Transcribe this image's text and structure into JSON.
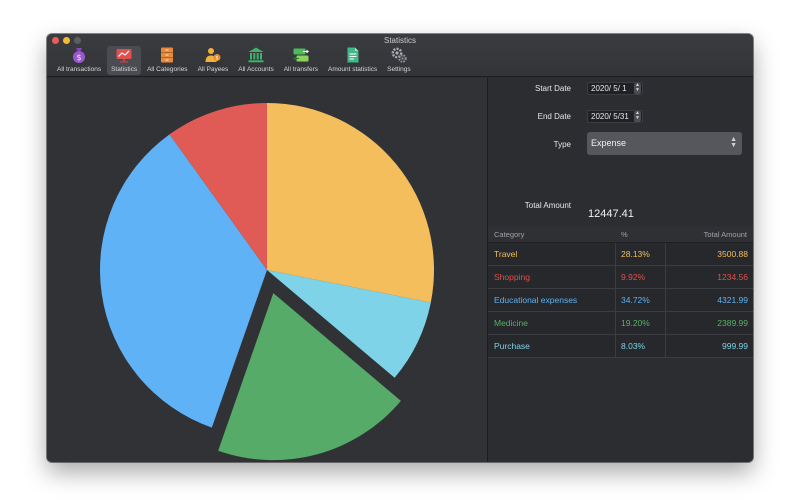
{
  "window": {
    "title": "Statistics"
  },
  "toolbar": {
    "items": [
      {
        "label": "All transactions",
        "icon": "money-bag-icon",
        "color": "#9b59d0",
        "active": false
      },
      {
        "label": "Statistics",
        "icon": "chart-icon",
        "color": "#e0504c",
        "active": true
      },
      {
        "label": "All Categories",
        "icon": "cabinet-icon",
        "color": "#e88a3c",
        "active": false
      },
      {
        "label": "All Payees",
        "icon": "people-icon",
        "color": "#f1b23d",
        "active": false
      },
      {
        "label": "All Accounts",
        "icon": "bank-icon",
        "color": "#3fb26b",
        "active": false
      },
      {
        "label": "All transfers",
        "icon": "transfer-icon",
        "color": "#4dbb5a",
        "active": false
      },
      {
        "label": "Amount statistics",
        "icon": "document-icon",
        "color": "#3fb98a",
        "active": false
      },
      {
        "label": "Settings",
        "icon": "gears-icon",
        "color": "#9aa0a6",
        "active": false
      }
    ]
  },
  "form": {
    "start_date_label": "Start Date",
    "start_date_value": "2020/ 5/ 1",
    "end_date_label": "End Date",
    "end_date_value": "2020/ 5/31",
    "type_label": "Type",
    "type_value": "Expense",
    "total_label": "Total Amount",
    "total_value": "12447.41"
  },
  "table": {
    "headers": {
      "category": "Category",
      "percent": "%",
      "amount": "Total Amount"
    },
    "rows": [
      {
        "category": "Travel",
        "percent": "28.13%",
        "amount": "3500.88",
        "color": "#f5be5c"
      },
      {
        "category": "Shopping",
        "percent": "9.92%",
        "amount": "1234.56",
        "color": "#e0504c"
      },
      {
        "category": "Educational expenses",
        "percent": "34.72%",
        "amount": "4321.99",
        "color": "#5fb2f5"
      },
      {
        "category": "Medicine",
        "percent": "19.20%",
        "amount": "2389.99",
        "color": "#5aaf6a"
      },
      {
        "category": "Purchase",
        "percent": "8.03%",
        "amount": "999.99",
        "color": "#7ed3e8"
      }
    ]
  },
  "chart_data": {
    "type": "pie",
    "start_angle_deg": 90,
    "direction": "clockwise",
    "exploded": "Medicine",
    "slices": [
      {
        "label": "Travel",
        "value": 3500.88,
        "percent": 28.13,
        "color": "#f5be5c"
      },
      {
        "label": "Purchase",
        "value": 999.99,
        "percent": 8.03,
        "color": "#7ed3e8"
      },
      {
        "label": "Medicine",
        "value": 2389.99,
        "percent": 19.2,
        "color": "#55ab67"
      },
      {
        "label": "Educational expenses",
        "value": 4321.99,
        "percent": 34.72,
        "color": "#5fb2f5"
      },
      {
        "label": "Shopping",
        "value": 1234.56,
        "percent": 9.92,
        "color": "#e05a56"
      }
    ]
  }
}
